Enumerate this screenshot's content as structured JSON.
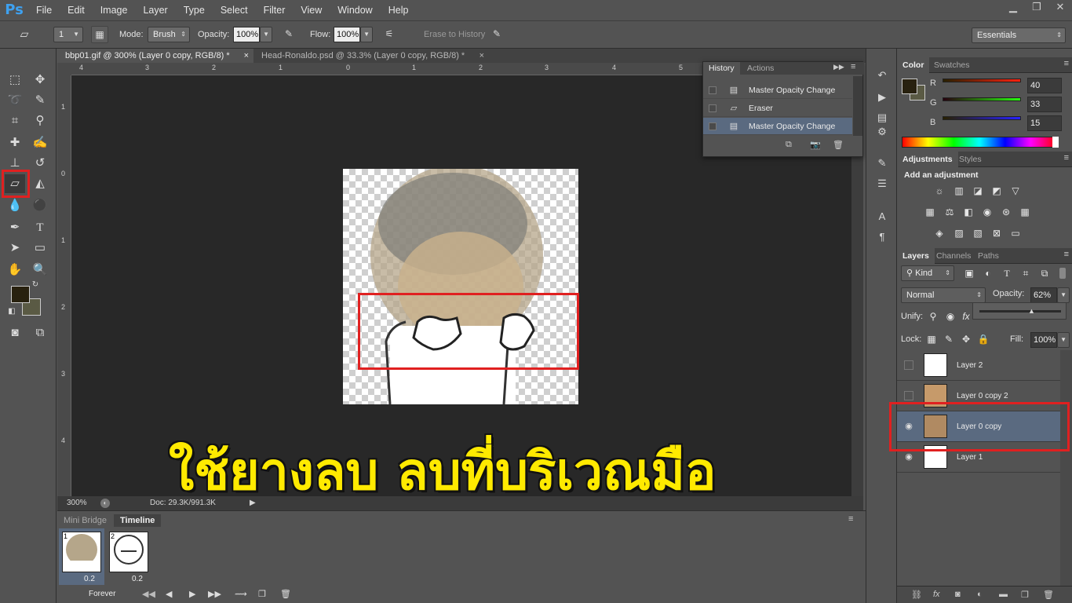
{
  "app": {
    "logo": "Ps",
    "menu": [
      "File",
      "Edit",
      "Image",
      "Layer",
      "Type",
      "Select",
      "Filter",
      "View",
      "Window",
      "Help"
    ]
  },
  "options": {
    "brush_size": "1",
    "mode_label": "Mode:",
    "mode_value": "Brush",
    "opacity_label": "Opacity:",
    "opacity_value": "100%",
    "flow_label": "Flow:",
    "flow_value": "100%",
    "erase_to_history": "Erase to History",
    "workspace": "Essentials"
  },
  "documents": {
    "tabs": [
      {
        "label": "bbp01.gif @ 300% (Layer 0 copy, RGB/8) *",
        "active": true
      },
      {
        "label": "Head-Ronaldo.psd @ 33.3% (Layer 0 copy, RGB/8) *",
        "active": false
      }
    ],
    "ruler_top": [
      "4",
      "3",
      "2",
      "1",
      "0",
      "1",
      "2",
      "3",
      "4",
      "5"
    ],
    "ruler_left": [
      "1",
      "0",
      "1",
      "2",
      "3",
      "4"
    ],
    "zoom": "300%",
    "doc_info": "Doc: 29.3K/991.3K"
  },
  "caption": "ใช้ยางลบ ลบที่บริเวณมือ",
  "history": {
    "tabs": [
      "History",
      "Actions"
    ],
    "items": [
      {
        "label": "Master Opacity Change",
        "icon": "doc-icon",
        "selected": false
      },
      {
        "label": "Eraser",
        "icon": "eraser-icon",
        "selected": false
      },
      {
        "label": "Master Opacity Change",
        "icon": "doc-icon",
        "selected": true
      }
    ]
  },
  "timeline": {
    "tabs": [
      "Mini Bridge",
      "Timeline"
    ],
    "frames": [
      {
        "num": "1",
        "delay": "0.2"
      },
      {
        "num": "2",
        "delay": "0.2"
      }
    ],
    "loop": "Forever"
  },
  "color": {
    "tabs": [
      "Color",
      "Swatches"
    ],
    "channels": [
      {
        "label": "R",
        "value": "40"
      },
      {
        "label": "G",
        "value": "33"
      },
      {
        "label": "B",
        "value": "15"
      }
    ],
    "foreground": "#28210f"
  },
  "adjustments": {
    "tabs": [
      "Adjustments",
      "Styles"
    ],
    "heading": "Add an adjustment"
  },
  "layers": {
    "tabs": [
      "Layers",
      "Channels",
      "Paths"
    ],
    "kind_label": "Kind",
    "blend_mode": "Normal",
    "opacity_label": "Opacity:",
    "opacity_value": "62%",
    "unify_label": "Unify:",
    "lock_label": "Lock:",
    "fill_label": "Fill:",
    "fill_value": "100%",
    "items": [
      {
        "name": "Layer 2",
        "visible": false,
        "selected": false
      },
      {
        "name": "Layer 0 copy 2",
        "visible": false,
        "selected": false
      },
      {
        "name": "Layer 0 copy",
        "visible": true,
        "selected": true
      },
      {
        "name": "Layer 1",
        "visible": true,
        "selected": false
      }
    ]
  },
  "colors": {
    "highlight": "#e02020",
    "caption": "#ffea00",
    "selection": "#5a6a80"
  }
}
